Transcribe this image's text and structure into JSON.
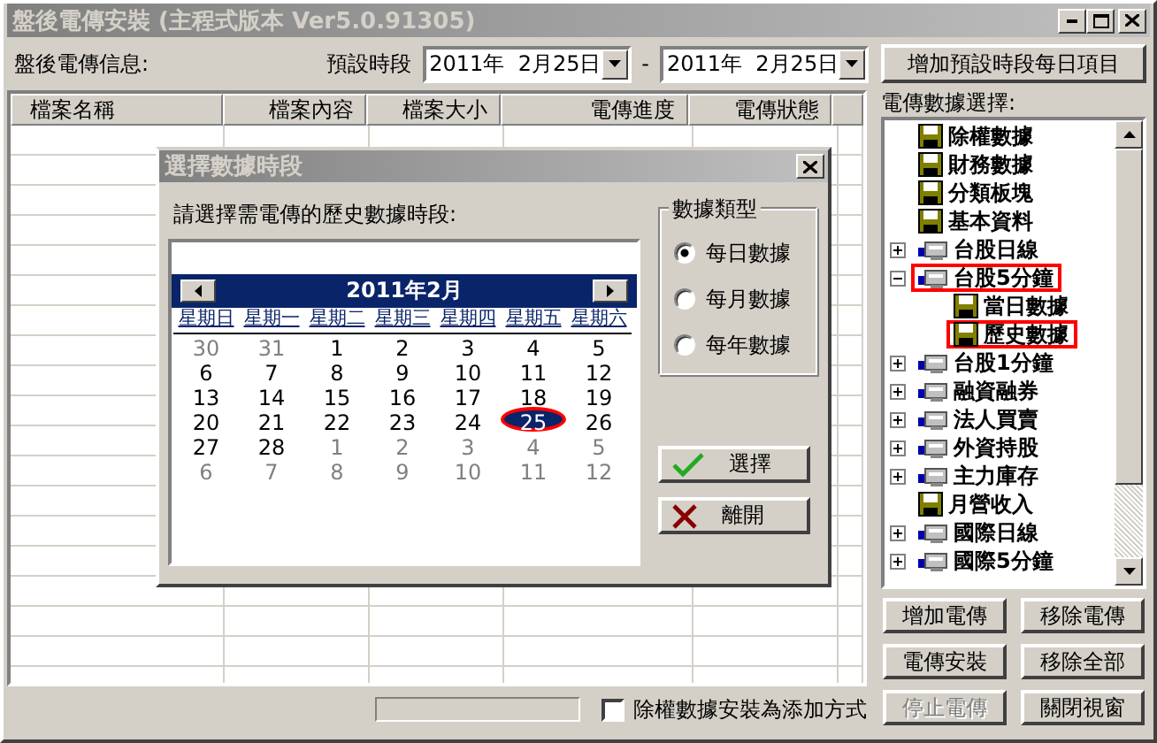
{
  "window": {
    "title": "盤後電傳安裝 (主程式版本 Ver5.0.91305)"
  },
  "toolbar": {
    "info_label": "盤後電傳信息:",
    "period_label": "預設時段",
    "start_date": "2011年  2月25日",
    "separator": "-",
    "end_date": "2011年  2月25日",
    "add_button": "增加預設時段每日項目"
  },
  "table": {
    "columns": [
      "檔案名稱",
      "檔案內容",
      "檔案大小",
      "電傳進度",
      "電傳狀態"
    ]
  },
  "footer": {
    "progress": {
      "level": 0
    },
    "option": {
      "label": "除權數據安裝為添加方式",
      "checked": false
    }
  },
  "panel": {
    "label": "電傳數據選擇:",
    "tree": [
      {
        "label": "除權數據",
        "kind": "disk",
        "highlighted": false
      },
      {
        "label": "財務數據",
        "kind": "disk",
        "highlighted": false
      },
      {
        "label": "分類板塊",
        "kind": "disk",
        "highlighted": false
      },
      {
        "label": "基本資料",
        "kind": "disk",
        "highlighted": false
      },
      {
        "label": "台股日線",
        "kind": "group",
        "expanded": false,
        "highlighted": false
      },
      {
        "label": "台股5分鐘",
        "kind": "group",
        "expanded": true,
        "highlighted": true,
        "children": [
          {
            "label": "當日數據",
            "kind": "disk",
            "highlighted": false
          },
          {
            "label": "歷史數據",
            "kind": "disk",
            "highlighted": true
          }
        ]
      },
      {
        "label": "台股1分鐘",
        "kind": "group",
        "expanded": false,
        "highlighted": false
      },
      {
        "label": "融資融券",
        "kind": "group",
        "expanded": false,
        "highlighted": false
      },
      {
        "label": "法人買賣",
        "kind": "group",
        "expanded": false,
        "highlighted": false
      },
      {
        "label": "外資持股",
        "kind": "group",
        "expanded": false,
        "highlighted": false
      },
      {
        "label": "主力庫存",
        "kind": "group",
        "expanded": false,
        "highlighted": false
      },
      {
        "label": "月營收入",
        "kind": "disk",
        "highlighted": false
      },
      {
        "label": "國際日線",
        "kind": "group",
        "expanded": false,
        "highlighted": false
      },
      {
        "label": "國際5分鐘",
        "kind": "group",
        "expanded": false,
        "highlighted": false
      }
    ],
    "buttons": [
      {
        "label": "增加電傳",
        "disabled": false
      },
      {
        "label": "移除電傳",
        "disabled": false
      },
      {
        "label": "電傳安裝",
        "disabled": false
      },
      {
        "label": "移除全部",
        "disabled": false
      },
      {
        "label": "停止電傳",
        "disabled": true
      },
      {
        "label": "關閉視窗",
        "disabled": false
      }
    ]
  },
  "dialog": {
    "title": "選擇數據時段",
    "prompt": "請選擇需電傳的歷史數據時段:",
    "calendar": {
      "month": "2011年2月",
      "weekdays": [
        "星期日",
        "星期一",
        "星期二",
        "星期三",
        "星期四",
        "星期五",
        "星期六"
      ],
      "days": [
        {
          "day": "30",
          "muted": true,
          "selected": false,
          "circled": false
        },
        {
          "day": "31",
          "muted": true,
          "selected": false,
          "circled": false
        },
        {
          "day": "1",
          "muted": false,
          "selected": false,
          "circled": false
        },
        {
          "day": "2",
          "muted": false,
          "selected": false,
          "circled": false
        },
        {
          "day": "3",
          "muted": false,
          "selected": false,
          "circled": false
        },
        {
          "day": "4",
          "muted": false,
          "selected": false,
          "circled": false
        },
        {
          "day": "5",
          "muted": false,
          "selected": false,
          "circled": false
        },
        {
          "day": "6",
          "muted": false,
          "selected": false,
          "circled": false
        },
        {
          "day": "7",
          "muted": false,
          "selected": false,
          "circled": false
        },
        {
          "day": "8",
          "muted": false,
          "selected": false,
          "circled": false
        },
        {
          "day": "9",
          "muted": false,
          "selected": false,
          "circled": false
        },
        {
          "day": "10",
          "muted": false,
          "selected": false,
          "circled": false
        },
        {
          "day": "11",
          "muted": false,
          "selected": false,
          "circled": false
        },
        {
          "day": "12",
          "muted": false,
          "selected": false,
          "circled": false
        },
        {
          "day": "13",
          "muted": false,
          "selected": false,
          "circled": false
        },
        {
          "day": "14",
          "muted": false,
          "selected": false,
          "circled": false
        },
        {
          "day": "15",
          "muted": false,
          "selected": false,
          "circled": false
        },
        {
          "day": "16",
          "muted": false,
          "selected": false,
          "circled": false
        },
        {
          "day": "17",
          "muted": false,
          "selected": false,
          "circled": false
        },
        {
          "day": "18",
          "muted": false,
          "selected": false,
          "circled": false
        },
        {
          "day": "19",
          "muted": false,
          "selected": false,
          "circled": false
        },
        {
          "day": "20",
          "muted": false,
          "selected": false,
          "circled": false
        },
        {
          "day": "21",
          "muted": false,
          "selected": false,
          "circled": false
        },
        {
          "day": "22",
          "muted": false,
          "selected": false,
          "circled": false
        },
        {
          "day": "23",
          "muted": false,
          "selected": false,
          "circled": false
        },
        {
          "day": "24",
          "muted": false,
          "selected": false,
          "circled": false
        },
        {
          "day": "25",
          "muted": false,
          "selected": true,
          "circled": true
        },
        {
          "day": "26",
          "muted": false,
          "selected": false,
          "circled": false
        },
        {
          "day": "27",
          "muted": false,
          "selected": false,
          "circled": false
        },
        {
          "day": "28",
          "muted": false,
          "selected": false,
          "circled": false
        },
        {
          "day": "1",
          "muted": true,
          "selected": false,
          "circled": false
        },
        {
          "day": "2",
          "muted": true,
          "selected": false,
          "circled": false
        },
        {
          "day": "3",
          "muted": true,
          "selected": false,
          "circled": false
        },
        {
          "day": "4",
          "muted": true,
          "selected": false,
          "circled": false
        },
        {
          "day": "5",
          "muted": true,
          "selected": false,
          "circled": false
        },
        {
          "day": "6",
          "muted": true,
          "selected": false,
          "circled": false
        },
        {
          "day": "7",
          "muted": true,
          "selected": false,
          "circled": false
        },
        {
          "day": "8",
          "muted": true,
          "selected": false,
          "circled": false
        },
        {
          "day": "9",
          "muted": true,
          "selected": false,
          "circled": false
        },
        {
          "day": "10",
          "muted": true,
          "selected": false,
          "circled": false
        },
        {
          "day": "11",
          "muted": true,
          "selected": false,
          "circled": false
        },
        {
          "day": "12",
          "muted": true,
          "selected": false,
          "circled": false
        }
      ]
    },
    "data_type": {
      "title": "數據類型",
      "options": [
        {
          "label": "每日數據",
          "selected": true
        },
        {
          "label": "每月數據",
          "selected": false
        },
        {
          "label": "每年數據",
          "selected": false
        }
      ]
    },
    "buttons": [
      {
        "label": "選擇",
        "kind": "ok"
      },
      {
        "label": "離開",
        "kind": "cancel"
      }
    ]
  }
}
